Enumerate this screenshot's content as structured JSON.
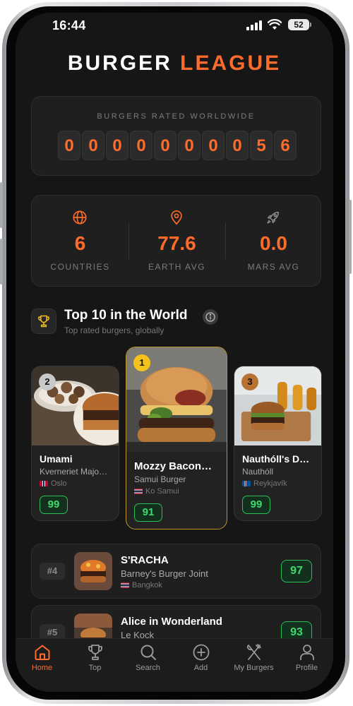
{
  "status_bar": {
    "time": "16:44",
    "battery": "52"
  },
  "brand": {
    "word1": "BURGER",
    "word2": "LEAGUE"
  },
  "counter": {
    "label": "BURGERS RATED WORLDWIDE",
    "digits": [
      "0",
      "0",
      "0",
      "0",
      "0",
      "0",
      "0",
      "0",
      "5",
      "6"
    ]
  },
  "stats": [
    {
      "icon": "globe-icon",
      "value": "6",
      "label": "COUNTRIES"
    },
    {
      "icon": "map-pin-icon",
      "value": "77.6",
      "label": "EARTH AVG"
    },
    {
      "icon": "rocket-icon",
      "value": "0.0",
      "label": "MARS AVG"
    }
  ],
  "top10": {
    "title": "Top 10 in the World",
    "subtitle": "Top rated burgers, globally",
    "podium": [
      {
        "rank": "2",
        "name": "Umami",
        "restaurant": "Kverneriet Majo…",
        "location": "Oslo",
        "score": "99",
        "rank_color": "#c9c9c9"
      },
      {
        "rank": "1",
        "name": "Mozzy Bacon…",
        "restaurant": "Samui Burger",
        "location": "Ko Samui",
        "score": "91",
        "rank_color": "#f4c21a"
      },
      {
        "rank": "3",
        "name": "Nauthóll's D…",
        "restaurant": "Nauthóll",
        "location": "Reykjavík",
        "score": "99",
        "rank_color": "#b87333"
      }
    ],
    "list": [
      {
        "rank": "#4",
        "name": "S'RACHA",
        "restaurant": "Barney's Burger Joint",
        "location": "Bangkok",
        "score": "97"
      },
      {
        "rank": "#5",
        "name": "Alice in Wonderland",
        "restaurant": "Le Kock",
        "location": "",
        "score": "93"
      }
    ]
  },
  "tabs": [
    {
      "label": "Home",
      "icon": "home-icon",
      "active": true
    },
    {
      "label": "Top",
      "icon": "trophy-icon",
      "active": false
    },
    {
      "label": "Search",
      "icon": "search-icon",
      "active": false
    },
    {
      "label": "Add",
      "icon": "plus-circle-icon",
      "active": false
    },
    {
      "label": "My Burgers",
      "icon": "utensils-icon",
      "active": false
    },
    {
      "label": "Profile",
      "icon": "person-icon",
      "active": false
    }
  ],
  "colors": {
    "accent": "#ff6b2b",
    "score_green": "#3fd96c",
    "background": "#161616",
    "gold": "#f4c21a"
  }
}
